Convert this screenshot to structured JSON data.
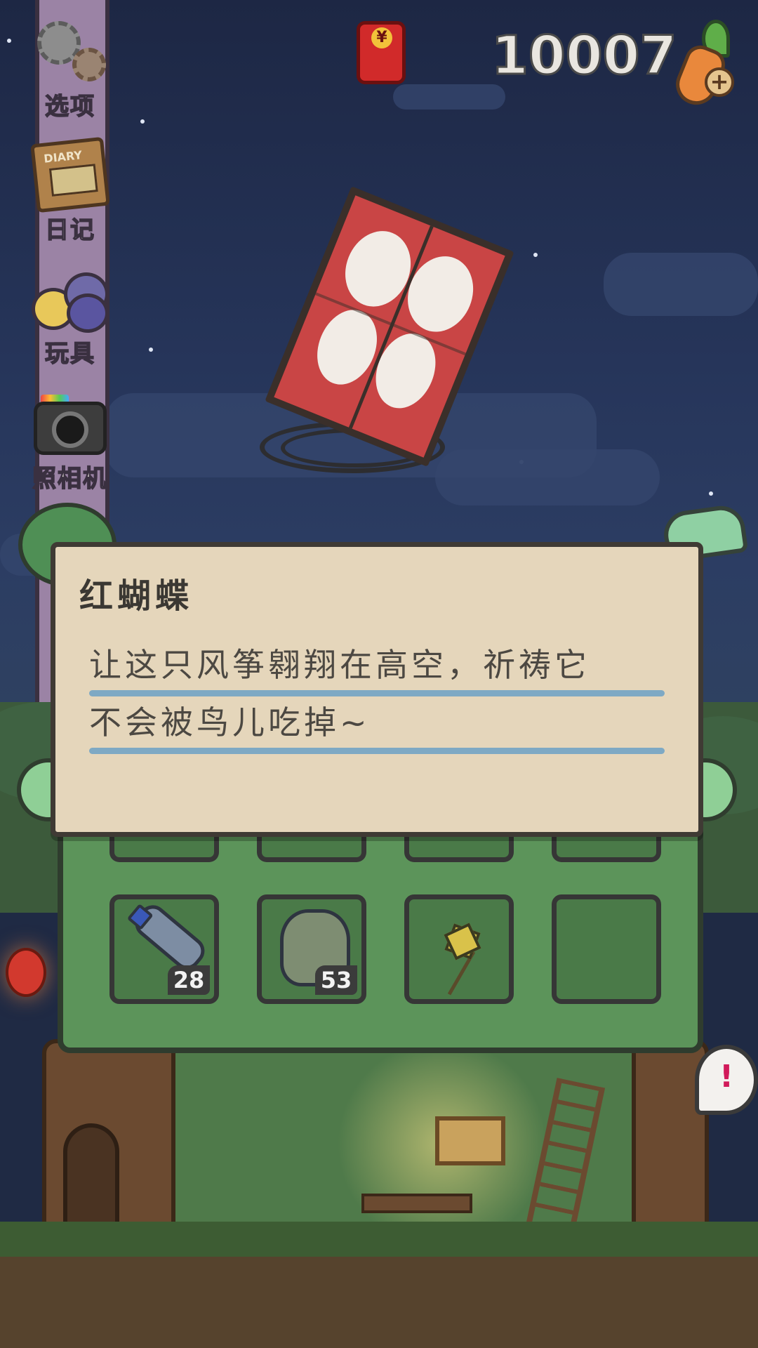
{
  "sidebar": {
    "items": [
      {
        "label": "选项",
        "icon": "gear-icon"
      },
      {
        "label": "日记",
        "icon": "diary-icon",
        "icon_text": "DIARY"
      },
      {
        "label": "玩具",
        "icon": "toys-icon"
      },
      {
        "label": "照相机",
        "icon": "camera-icon"
      }
    ]
  },
  "hud": {
    "clover_count": "10007",
    "red_packet_icon": "red-packet-icon",
    "carrot_icon": "carrot-plus-icon"
  },
  "dialog": {
    "title": "红蝴蝶",
    "lines": [
      "让这只风筝翱翔在高空，祈祷它",
      "不会被鸟儿吃掉~"
    ]
  },
  "bag": {
    "items": [
      {
        "icon": "plastic-bottle-icon",
        "count": "28"
      },
      {
        "icon": "pot-icon",
        "count": "53"
      },
      {
        "icon": "pinwheel-icon",
        "count": ""
      },
      {
        "icon": "",
        "count": ""
      }
    ]
  },
  "colors": {
    "dialog_bg": "#e5d6bb",
    "rule_blue": "#7ea9c4",
    "bag_green": "#5c945a",
    "kite_red": "#c94545"
  }
}
